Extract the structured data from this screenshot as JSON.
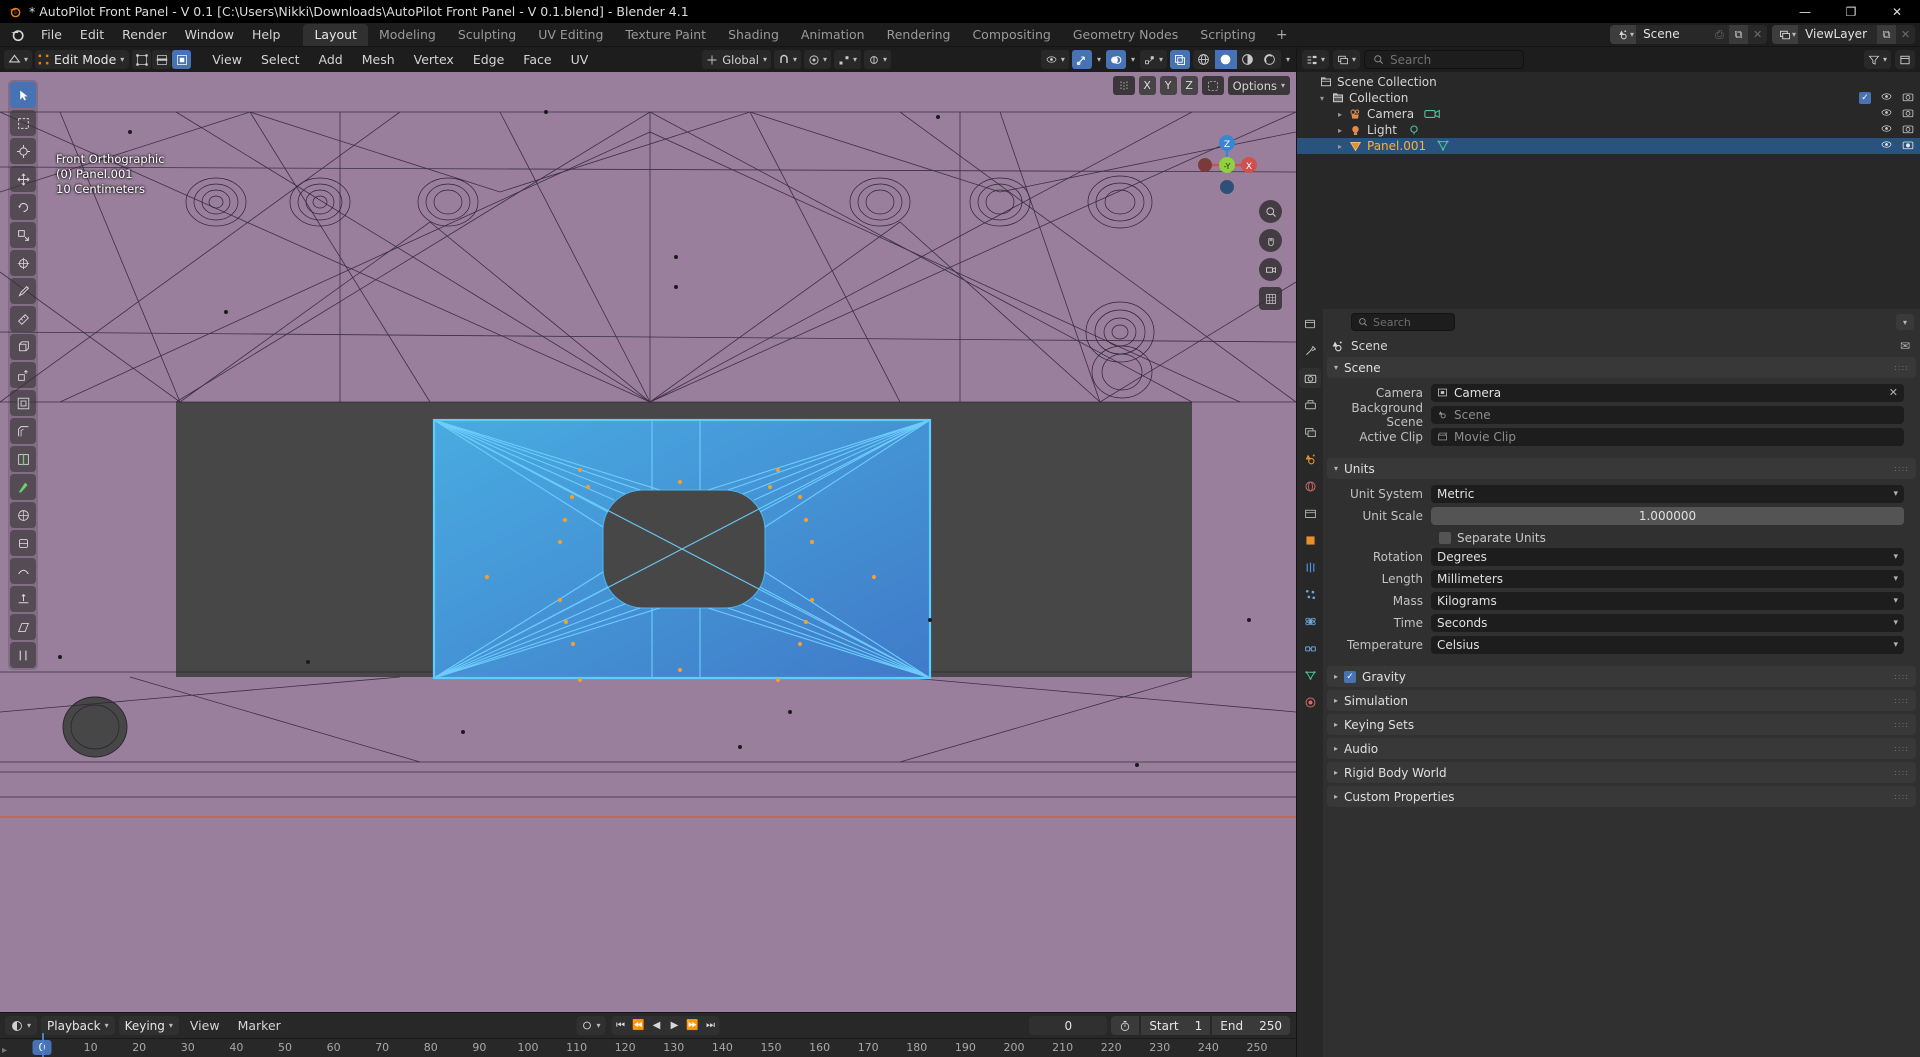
{
  "window": {
    "title": "* AutoPilot Front Panel - V 0.1 [C:\\Users\\Nikki\\Downloads\\AutoPilot Front Panel - V 0.1.blend] - Blender 4.1",
    "minimize": "—",
    "maximize": "❐",
    "close": "✕"
  },
  "menus": [
    "File",
    "Edit",
    "Render",
    "Window",
    "Help"
  ],
  "workspaces": {
    "tabs": [
      "Layout",
      "Modeling",
      "Sculpting",
      "UV Editing",
      "Texture Paint",
      "Shading",
      "Animation",
      "Rendering",
      "Compositing",
      "Geometry Nodes",
      "Scripting"
    ],
    "active": "Layout",
    "add_label": "+"
  },
  "topbar_right": {
    "scene_name": "Scene",
    "viewlayer_name": "ViewLayer",
    "new_label": "⧉",
    "unlink_label": "✕",
    "pin_label": "⎙"
  },
  "viewport_header": {
    "mode": "Edit Mode",
    "menus": [
      "View",
      "Select",
      "Add",
      "Mesh",
      "Vertex",
      "Edge",
      "Face",
      "UV"
    ],
    "transform_orientation": "Global",
    "options_label": "Options"
  },
  "viewport": {
    "view_name": "Front Orthographic",
    "collection_name": "(0) Panel.001",
    "grid_scale": "10 Centimeters",
    "axis_buttons": [
      "X",
      "Y",
      "Z"
    ],
    "gizmo_axes": {
      "x": "X",
      "y": "-Y",
      "z": "Z"
    },
    "background_color": "#9a7f9d",
    "selection_color": "#39b6f0",
    "face_fill_color": "#3b9ee8"
  },
  "timeline": {
    "menus": [
      "View",
      "Marker"
    ],
    "playback_label": "Playback",
    "keying_label": "Keying",
    "current_frame": "0",
    "start_label": "Start",
    "start_value": "1",
    "end_label": "End",
    "end_value": "250",
    "ticks": [
      "0",
      "10",
      "20",
      "30",
      "40",
      "50",
      "60",
      "70",
      "80",
      "90",
      "100",
      "110",
      "120",
      "130",
      "140",
      "150",
      "160",
      "170",
      "180",
      "190",
      "200",
      "210",
      "220",
      "230",
      "240",
      "250"
    ],
    "playhead_frame": "0"
  },
  "outliner": {
    "search_placeholder": "Search",
    "rows": [
      {
        "label": "Scene Collection",
        "icon": "collection-icon",
        "indent": 0,
        "selected": false,
        "expandable": false,
        "badge": null
      },
      {
        "label": "Collection",
        "icon": "collection-icon",
        "indent": 1,
        "selected": false,
        "expandable": true,
        "badge": null,
        "checkbox": true
      },
      {
        "label": "Camera",
        "icon": "camera-object-icon",
        "indent": 2,
        "selected": false,
        "expandable": true,
        "badge": "camera-data-icon"
      },
      {
        "label": "Light",
        "icon": "light-object-icon",
        "indent": 2,
        "selected": false,
        "expandable": true,
        "badge": "light-data-icon"
      },
      {
        "label": "Panel.001",
        "icon": "mesh-object-icon",
        "indent": 2,
        "selected": true,
        "expandable": true,
        "badge": "mesh-data-icon"
      }
    ]
  },
  "properties": {
    "search_placeholder": "Search",
    "breadcrumb": "Scene",
    "panels": [
      {
        "title": "Scene",
        "open": true,
        "rows": [
          {
            "label": "Camera",
            "value": "Camera",
            "type": "object",
            "clearable": true
          },
          {
            "label": "Background Scene",
            "value": "Scene",
            "type": "object",
            "muted": true
          },
          {
            "label": "Active Clip",
            "value": "Movie Clip",
            "type": "object",
            "muted": true
          }
        ]
      },
      {
        "title": "Units",
        "open": true,
        "rows": [
          {
            "label": "Unit System",
            "value": "Metric",
            "type": "dropdown"
          },
          {
            "label": "Unit Scale",
            "value": "1.000000",
            "type": "number"
          },
          {
            "label": "Separate Units",
            "value": "",
            "type": "checkbox",
            "checked": false
          },
          {
            "label": "Rotation",
            "value": "Degrees",
            "type": "dropdown"
          },
          {
            "label": "Length",
            "value": "Millimeters",
            "type": "dropdown"
          },
          {
            "label": "Mass",
            "value": "Kilograms",
            "type": "dropdown"
          },
          {
            "label": "Time",
            "value": "Seconds",
            "type": "dropdown"
          },
          {
            "label": "Temperature",
            "value": "Celsius",
            "type": "dropdown"
          }
        ]
      }
    ],
    "collapsed": [
      {
        "title": "Gravity",
        "checkbox": true,
        "checked": true
      },
      {
        "title": "Simulation",
        "checkbox": false
      },
      {
        "title": "Keying Sets",
        "checkbox": false
      },
      {
        "title": "Audio",
        "checkbox": false
      },
      {
        "title": "Rigid Body World",
        "checkbox": false
      },
      {
        "title": "Custom Properties",
        "checkbox": false
      }
    ]
  }
}
